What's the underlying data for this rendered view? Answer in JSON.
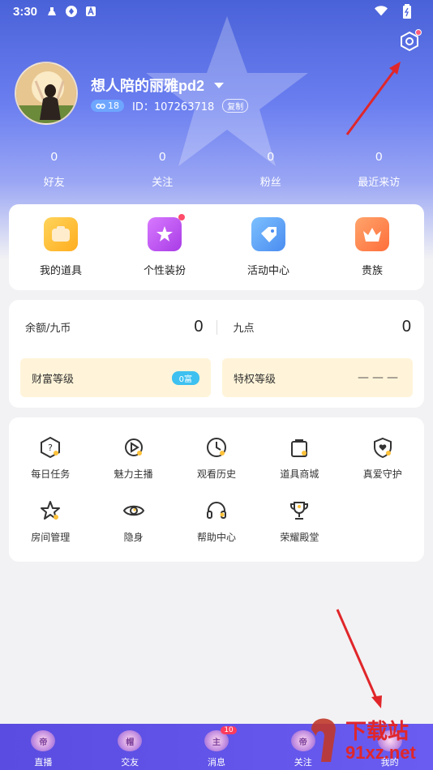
{
  "status_bar": {
    "time": "3:30"
  },
  "profile": {
    "username": "想人陪的丽雅pd2",
    "level": "18",
    "id_text": "ID：107263718",
    "copy_label": "复制"
  },
  "stats": [
    {
      "value": "0",
      "label": "好友"
    },
    {
      "value": "0",
      "label": "关注"
    },
    {
      "value": "0",
      "label": "粉丝"
    },
    {
      "value": "0",
      "label": "最近来访"
    }
  ],
  "quick_actions": [
    {
      "label": "我的道具",
      "color": "#ffc23a",
      "icon": "toolbox-icon"
    },
    {
      "label": "个性装扮",
      "color": "#c65cf2",
      "icon": "magic-wand-icon",
      "dot": true
    },
    {
      "label": "活动中心",
      "color": "#5ca7f7",
      "icon": "ticket-icon"
    },
    {
      "label": "贵族",
      "color": "#ff8a4c",
      "icon": "crown-icon"
    }
  ],
  "wallet": {
    "balance_label": "余额/九币",
    "balance_value": "0",
    "points_label": "九点",
    "points_value": "0",
    "wealth_label": "财富等级",
    "wealth_badge": "0富",
    "privilege_label": "特权等级",
    "privilege_value": "———"
  },
  "tools": [
    {
      "label": "每日任务",
      "icon": "daily-task-icon"
    },
    {
      "label": "魅力主播",
      "icon": "charm-anchor-icon"
    },
    {
      "label": "观看历史",
      "icon": "history-icon"
    },
    {
      "label": "道具商城",
      "icon": "shop-icon"
    },
    {
      "label": "真爱守护",
      "icon": "heart-shield-icon"
    },
    {
      "label": "房间管理",
      "icon": "star-icon"
    },
    {
      "label": "隐身",
      "icon": "eye-icon"
    },
    {
      "label": "帮助中心",
      "icon": "headset-icon"
    },
    {
      "label": "荣耀殿堂",
      "icon": "trophy-icon"
    }
  ],
  "tabbar": [
    {
      "label": "直播",
      "glyph": "帝"
    },
    {
      "label": "交友",
      "glyph": "帽"
    },
    {
      "label": "消息",
      "glyph": "主",
      "badge": "10"
    },
    {
      "label": "关注",
      "glyph": "帝"
    },
    {
      "label": "我的",
      "glyph": ""
    }
  ],
  "watermark": {
    "text": "下载站",
    "url": "91xz.net"
  },
  "colors": {
    "accent": "#5a4ce0",
    "arrow": "#e0262a"
  }
}
